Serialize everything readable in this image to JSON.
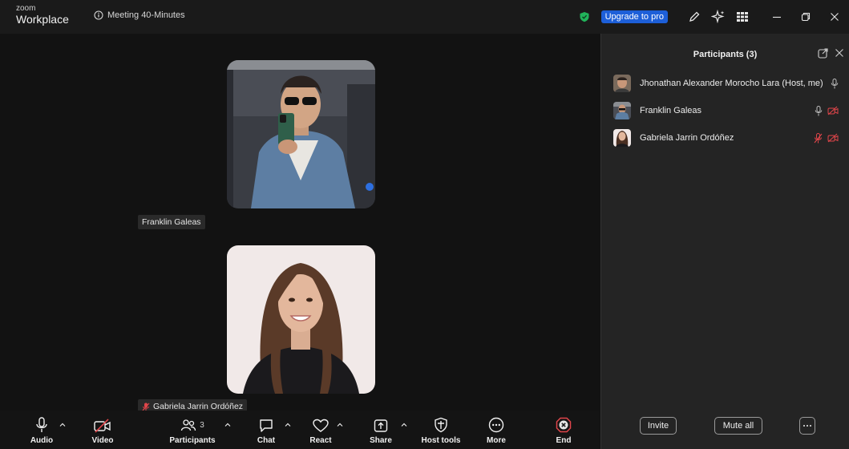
{
  "app": {
    "brand_small": "zoom",
    "brand_large": "Workplace",
    "meeting_title": "Meeting 40-Minutes"
  },
  "titlebar": {
    "upgrade_label": "Upgrade to pro",
    "icons": [
      "shield-check-icon",
      "pen-icon",
      "sparkle-icon",
      "apps-grid-icon"
    ],
    "window_controls": [
      "minimize-icon",
      "restore-icon",
      "close-icon"
    ]
  },
  "stage": {
    "tiles": [
      {
        "name": "Franklin Galeas",
        "muted": false,
        "subject": "man with sunglasses taking mirror selfie"
      },
      {
        "name": "Gabriela Jarrin Ordóñez",
        "muted": true,
        "subject": "smiling woman portrait"
      }
    ]
  },
  "toolbar": {
    "audio": "Audio",
    "video": "Video",
    "participants": "Participants",
    "participants_count": "3",
    "chat": "Chat",
    "react": "React",
    "share": "Share",
    "host_tools": "Host tools",
    "more": "More",
    "end": "End"
  },
  "panel": {
    "title": "Participants (3)",
    "participants": [
      {
        "name": "Jhonathan Alexander Morocho Lara (Host, me)",
        "mic": "on",
        "video": "none"
      },
      {
        "name": "Franklin Galeas",
        "mic": "on",
        "video": "off"
      },
      {
        "name": "Gabriela Jarrin Ordóñez",
        "mic": "muted",
        "video": "off"
      }
    ],
    "invite_label": "Invite",
    "mute_all_label": "Mute all"
  },
  "colors": {
    "accent_blue": "#1d5fd8",
    "muted_red": "#e0454a",
    "shield_green": "#21b35a",
    "end_red": "#e0454a"
  }
}
